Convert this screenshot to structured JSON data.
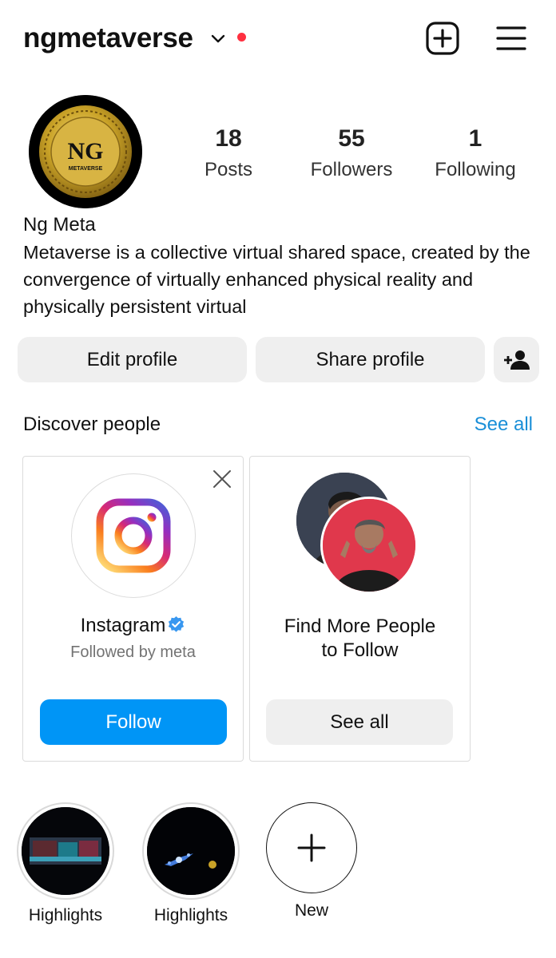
{
  "header": {
    "username": "ngmetaverse",
    "icons": [
      "chevron-down-icon",
      "notification-dot",
      "create-plus-icon",
      "menu-icon"
    ],
    "dot_color": "#ff3040"
  },
  "profile": {
    "avatar_text": "NG",
    "avatar_subtext": "METAVERSE",
    "stats": [
      {
        "value": "18",
        "label": "Posts"
      },
      {
        "value": "55",
        "label": "Followers"
      },
      {
        "value": "1",
        "label": "Following"
      }
    ],
    "full_name": "Ng Meta",
    "bio": "Metaverse is a collective virtual shared space, created by the convergence of virtually enhanced physical reality and physically persistent virtual"
  },
  "actions": {
    "edit_label": "Edit profile",
    "share_label": "Share profile",
    "add_user_icon": "add-person-icon"
  },
  "discover": {
    "title": "Discover people",
    "see_all": "See all",
    "cards": [
      {
        "name": "Instagram",
        "verified": true,
        "subtitle": "Followed by meta",
        "button": "Follow"
      },
      {
        "name": "Find More People to Follow",
        "button": "See all"
      }
    ]
  },
  "highlights": {
    "items": [
      {
        "label": "Highlights"
      },
      {
        "label": "Highlights"
      }
    ],
    "new_label": "New"
  },
  "colors": {
    "accent_blue": "#0095f6",
    "link_blue": "#1a8fd8",
    "button_gray": "#efefef",
    "gold": "#c9a227"
  }
}
